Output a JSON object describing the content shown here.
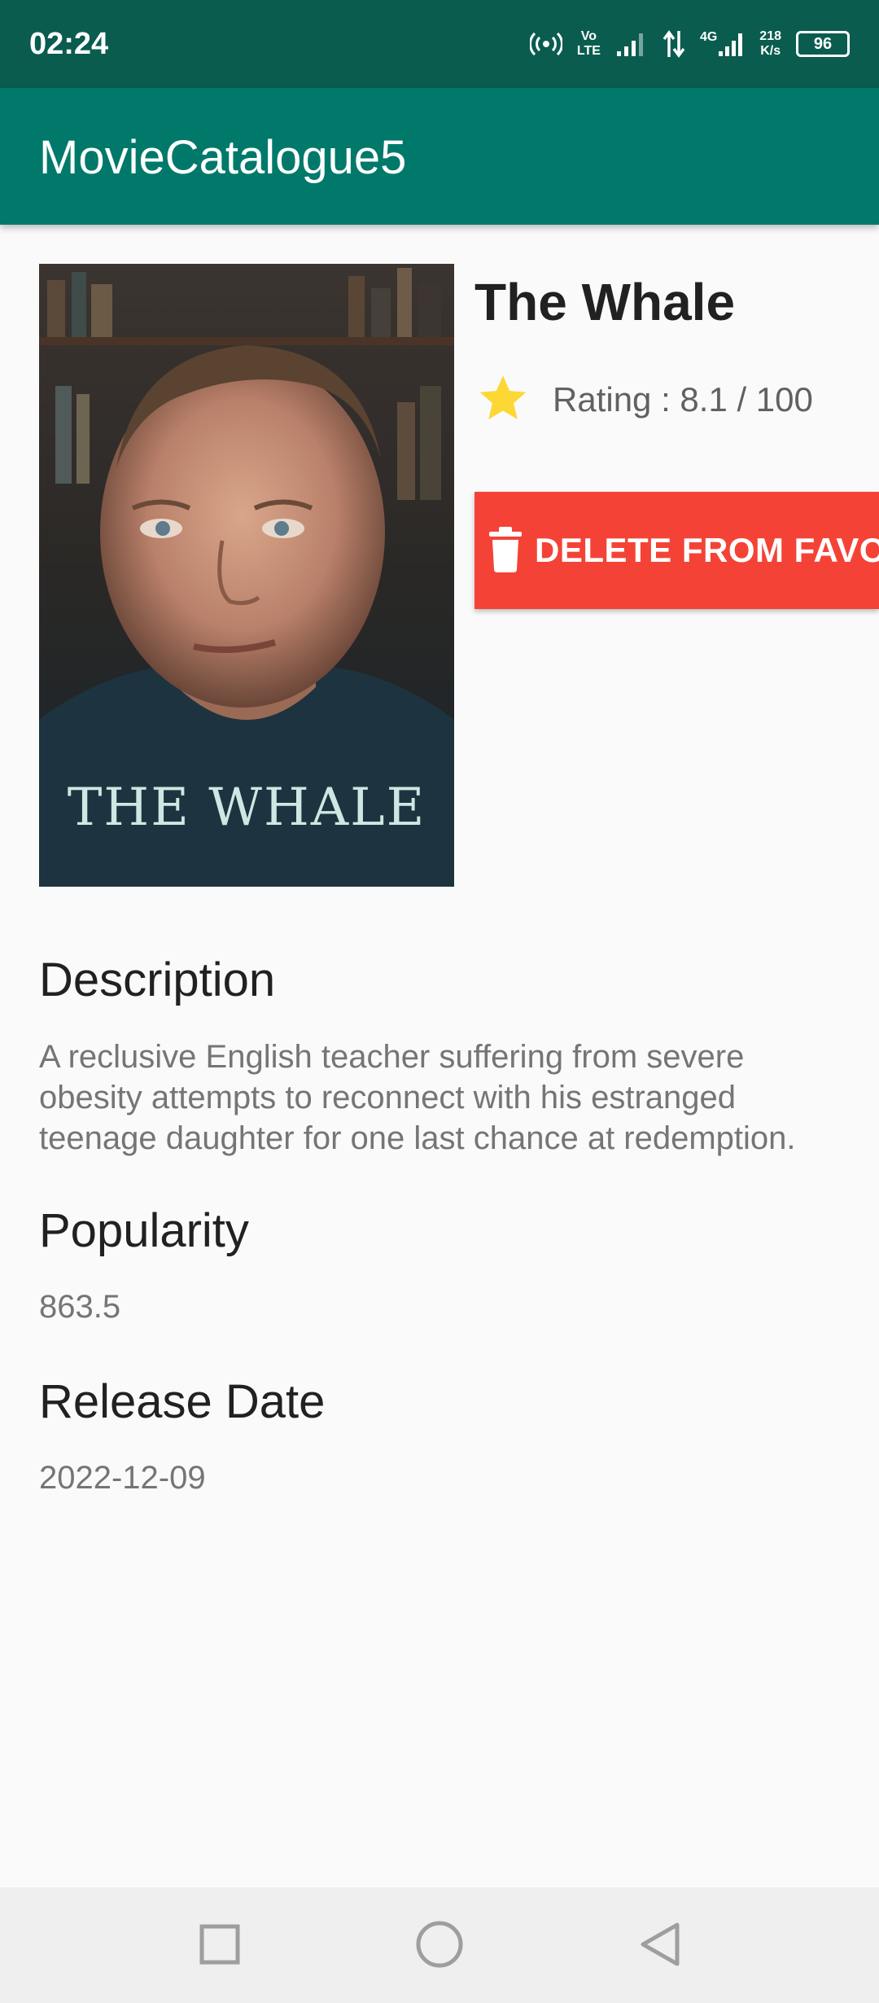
{
  "status_bar": {
    "time": "02:24",
    "volte_top": "Vo",
    "volte_bottom": "LTE",
    "network_type": "4G",
    "speed_value": "218",
    "speed_unit": "K/s",
    "battery_level": "96",
    "icons": [
      "hotspot-icon",
      "volte-icon",
      "signal-icon",
      "data-arrows-icon",
      "signal-4g-icon",
      "battery-icon"
    ]
  },
  "app_bar": {
    "title": "MovieCatalogue5"
  },
  "movie": {
    "poster_caption": "THE WHALE",
    "title": "The Whale",
    "rating_text": "Rating : 8.1 / 100",
    "delete_button_label": "DELETE FROM FAVORITE",
    "description_heading": "Description",
    "description": "A reclusive English teacher suffering from severe obesity attempts to reconnect with his estranged teenage daughter for one last chance at redemption.",
    "popularity_heading": "Popularity",
    "popularity": "863.5",
    "release_heading": "Release Date",
    "release_date": "2022-12-09"
  },
  "nav_bar": {
    "buttons": [
      "recents-button",
      "home-button",
      "back-button"
    ]
  },
  "colors": {
    "status_bar": "#0a5c4f",
    "app_bar": "#00796b",
    "delete_button": "#f44336",
    "star": "#fdd835",
    "background": "#fafafa"
  }
}
